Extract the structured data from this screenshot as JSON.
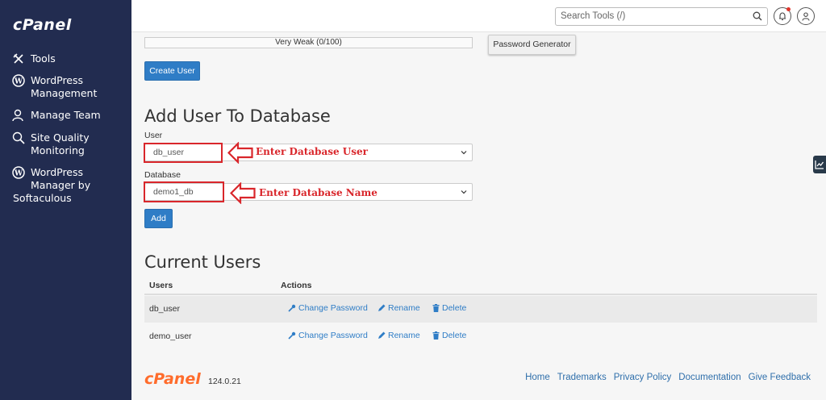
{
  "sidebar": {
    "logo": "cPanel",
    "items": [
      {
        "label": "Tools",
        "icon": "tools-icon"
      },
      {
        "label": "WordPress\nManagement",
        "icon": "wordpress-icon"
      },
      {
        "label": "Manage Team",
        "icon": "team-icon"
      },
      {
        "label": "Site Quality\nMonitoring",
        "icon": "site-quality-icon"
      },
      {
        "label": "WordPress\nManager by",
        "icon": "wordpress-icon"
      },
      {
        "label": "Softaculous"
      }
    ]
  },
  "header": {
    "search_placeholder": "Search Tools (/)"
  },
  "password": {
    "strength": "Very Weak (0/100)",
    "generator": "Password Generator",
    "create_user": "Create User"
  },
  "add_user": {
    "title": "Add User To Database",
    "user_label": "User",
    "user_value": "db_user",
    "user_annotation": "Enter Database User",
    "db_label": "Database",
    "db_value": "demo1_db",
    "db_annotation": "Enter Database Name",
    "add_button": "Add",
    "annotation_color": "#d9262b"
  },
  "current_users": {
    "title": "Current Users",
    "headers": [
      "Users",
      "Actions"
    ],
    "actions": [
      "Change Password",
      "Rename",
      "Delete"
    ],
    "rows": [
      {
        "user": "db_user"
      },
      {
        "user": "demo_user"
      }
    ]
  },
  "footer": {
    "logo": "cPanel",
    "version": "124.0.21",
    "links": [
      "Home",
      "Trademarks",
      "Privacy Policy",
      "Documentation",
      "Give Feedback"
    ]
  },
  "colors": {
    "sidebar": "#222c50",
    "accent": "#2f7dc6",
    "brand_orange": "#ff6c2c"
  }
}
